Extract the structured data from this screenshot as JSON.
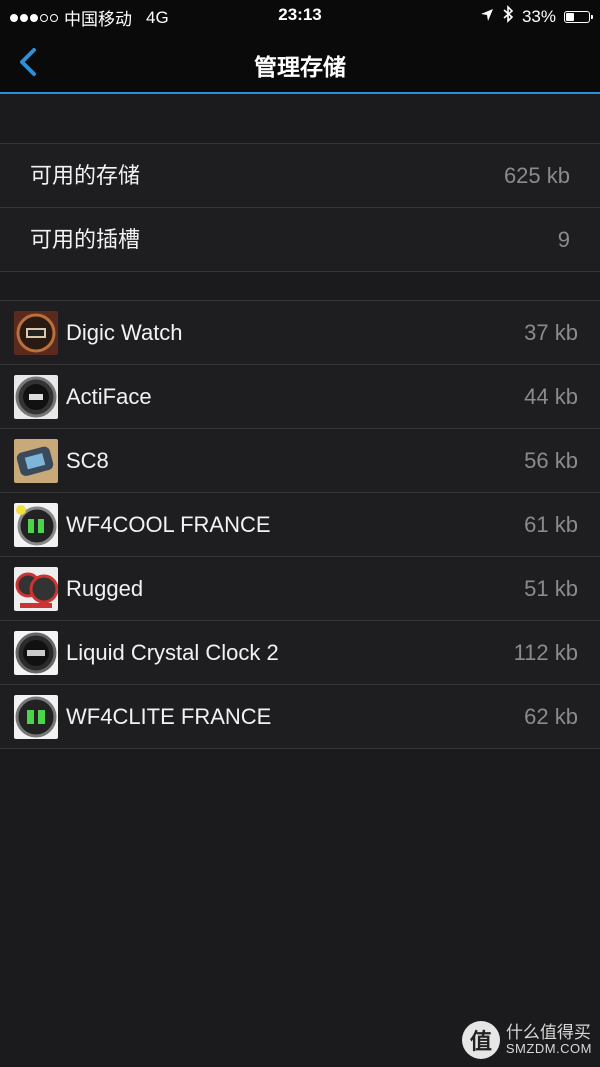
{
  "status_bar": {
    "signal_dots_filled": 3,
    "signal_dots_total": 5,
    "carrier": "中国移动",
    "network": "4G",
    "time": "23:13",
    "battery_percent_label": "33%",
    "battery_level": 0.33,
    "icons": [
      "location-arrow-icon",
      "bluetooth-icon",
      "battery-icon"
    ]
  },
  "nav": {
    "back_icon": "chevron-left-icon",
    "title": "管理存储",
    "accent_color": "#2e8fd6"
  },
  "storage_info": [
    {
      "label": "可用的存储",
      "value": "625 kb"
    },
    {
      "label": "可用的插槽",
      "value": "9"
    }
  ],
  "apps": [
    {
      "name": "Digic Watch",
      "size": "37 kb",
      "thumb": "thumb-digic-watch"
    },
    {
      "name": "ActiFace",
      "size": "44 kb",
      "thumb": "thumb-actiface"
    },
    {
      "name": "SC8",
      "size": "56 kb",
      "thumb": "thumb-sc8"
    },
    {
      "name": "WF4COOL FRANCE",
      "size": "61 kb",
      "thumb": "thumb-wf4cool"
    },
    {
      "name": "Rugged",
      "size": "51 kb",
      "thumb": "thumb-rugged"
    },
    {
      "name": "Liquid Crystal Clock 2",
      "size": "112 kb",
      "thumb": "thumb-liquid-crystal"
    },
    {
      "name": "WF4CLITE  FRANCE",
      "size": "62 kb",
      "thumb": "thumb-wf4clite"
    }
  ],
  "watermark": {
    "seal_char": "值",
    "cn": "什么值得买",
    "en": "SMZDM.COM"
  }
}
